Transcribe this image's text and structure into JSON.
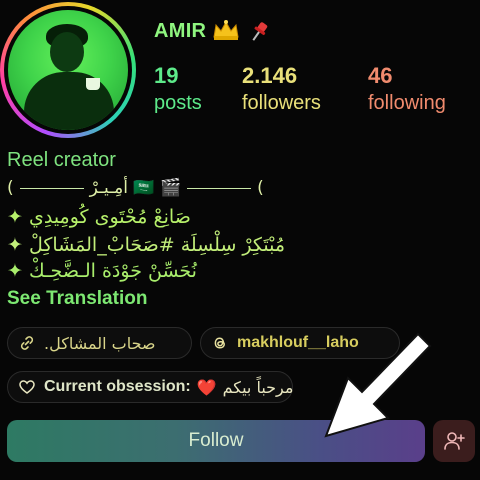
{
  "profile": {
    "username": "AMIR",
    "crown_emoji": "👑",
    "pin_emoji": "📌",
    "stats": [
      {
        "value": "19",
        "label": "posts"
      },
      {
        "value": "2.146",
        "label": "followers"
      },
      {
        "value": "46",
        "label": "following"
      }
    ],
    "category": "Reel creator"
  },
  "bio": {
    "line1": "أمِـيـرْ",
    "line1_flag": "🇸🇦",
    "line1_clapper": "🎬",
    "line1_open": "(",
    "line1_close": "(",
    "line2": "✦ صَانِعْ مُحْتَوى كُومِيدِي",
    "line3": "✦ مُبْتَكِرْ سِلْسِلَة #صَحَابْ_المَشَاكِلْ",
    "line4": "✦ نُحَسِّنْ جَوْدَة الـضَّحِـكْ",
    "see_translation": "See Translation"
  },
  "chips": {
    "link_text": "صحاب المشاكل.",
    "threads_handle": "makhlouf__laho",
    "obsession_label": "Current obsession:",
    "obsession_heart": "❤️",
    "obsession_text": "مرحباً بيكم"
  },
  "actions": {
    "follow_label": "Follow"
  },
  "colors": {
    "username": "#8ff57f",
    "posts": "#5dea8a",
    "followers": "#e9e07a",
    "following": "#f08b6e",
    "follow_gradient_start": "#2e7a63",
    "follow_gradient_end": "#5a3f8a",
    "add_user_bg": "#3b1d1d"
  },
  "icons": {
    "link": "link-icon",
    "threads": "threads-icon",
    "heart": "heart-outline-icon",
    "add_user": "add-user-icon",
    "cursor": "arrow-cursor-icon"
  }
}
